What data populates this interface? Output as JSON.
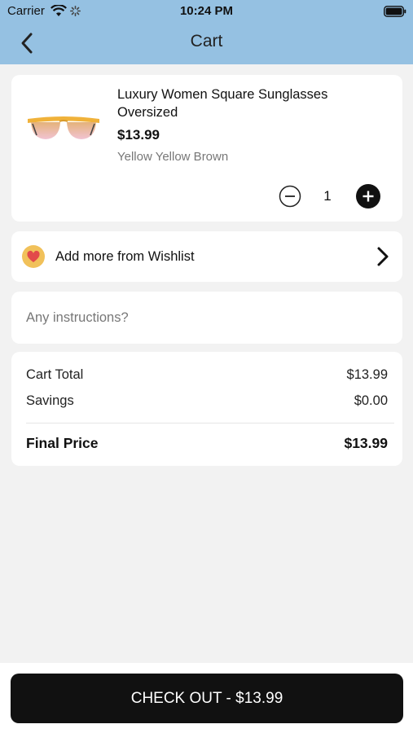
{
  "status_bar": {
    "carrier": "Carrier",
    "time": "10:24 PM"
  },
  "header": {
    "title": "Cart"
  },
  "cart_item": {
    "name": "Luxury Women Square Sunglasses Oversized",
    "price": "$13.99",
    "variant": "Yellow Yellow Brown",
    "quantity": "1"
  },
  "wishlist": {
    "label": "Add more from Wishlist"
  },
  "instructions": {
    "placeholder": "Any instructions?"
  },
  "summary": {
    "cart_total_label": "Cart Total",
    "cart_total_value": "$13.99",
    "savings_label": "Savings",
    "savings_value": "$0.00",
    "final_label": "Final Price",
    "final_value": "$13.99"
  },
  "checkout": {
    "label": "CHECK OUT - $13.99"
  },
  "colors": {
    "header_bg": "#95c1e2",
    "page_bg": "#f2f2f2",
    "button_bg": "#111111",
    "heart": "#e24a4a",
    "heart_badge": "#f1c15a"
  }
}
